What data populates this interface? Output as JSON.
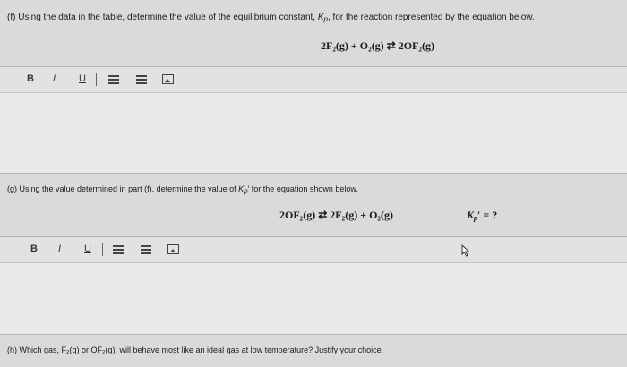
{
  "part_f": {
    "question_prefix": "(f) Using the data in the table, determine the value of the equilibrium constant, ",
    "question_kp": "K",
    "question_kp_sub": "p",
    "question_suffix": ", for the reaction represented by the equation below.",
    "equation": "2F₂(g) + O₂(g) ⇄ 2OF₂(g)"
  },
  "part_g": {
    "question_prefix": "(g) Using the value determined in part (f), determine the value of ",
    "question_kp": "K",
    "question_kp_sub": "p",
    "question_suffix": "′ for the equation shown below.",
    "equation": "2OF₂(g) ⇄ 2F₂(g) + O₂(g)",
    "kp_prime": "K",
    "kp_prime_sub": "p",
    "kp_prime_rest": "′ = ?"
  },
  "part_h": {
    "question": "(h) Which gas, F₂(g) or OF₂(g), will behave most like an ideal gas at low temperature? Justify your choice."
  },
  "toolbar": {
    "bold": "B",
    "italic": "I",
    "underline": "U"
  },
  "colors": {
    "background": "#d9dadb",
    "editor": "#e6e7e8",
    "text": "#1b1b1b"
  }
}
